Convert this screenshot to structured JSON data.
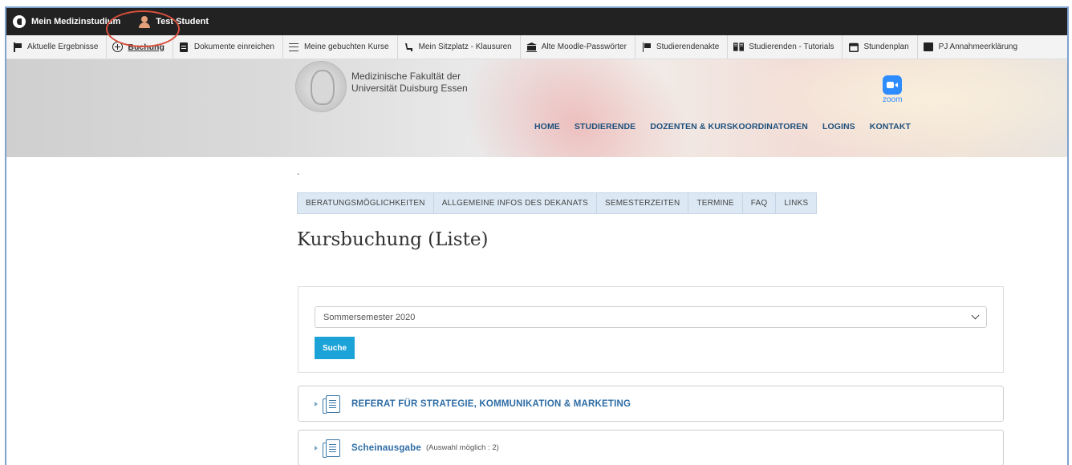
{
  "topbar": {
    "app_title": "Mein Medizinstudium",
    "user_name": "Test Student"
  },
  "navbar": {
    "items": [
      {
        "label": "Aktuelle Ergebnisse",
        "icon": "flag-icon"
      },
      {
        "label": "Buchung",
        "icon": "plus-circle-icon",
        "active": true
      },
      {
        "label": "Dokumente einreichen",
        "icon": "clipboard-icon"
      },
      {
        "label": "Meine gebuchten Kurse",
        "icon": "list-icon"
      },
      {
        "label": "Mein Sitzplatz - Klausuren",
        "icon": "seat-icon"
      },
      {
        "label": "Alte Moodle-Passwörter",
        "icon": "university-icon"
      },
      {
        "label": "Studierendenakte",
        "icon": "flag-icon"
      },
      {
        "label": "Studierenden - Tutorials",
        "icon": "book-icon"
      },
      {
        "label": "Stundenplan",
        "icon": "calendar-icon"
      },
      {
        "label": "PJ Annahmeerklärung",
        "icon": "document-icon"
      }
    ]
  },
  "header": {
    "faculty_line1": "Medizinische Fakultät der",
    "faculty_line2": "Universität Duisburg Essen",
    "zoom_label": "zoom",
    "mainnav": [
      "HOME",
      "STUDIERENDE",
      "DOZENTEN & KURSKOORDINATOREN",
      "LOGINS",
      "KONTAKT"
    ]
  },
  "content": {
    "dash": "-",
    "tabs": [
      "BERATUNGSMÖGLICHKEITEN",
      "ALLGEMEINE INFOS DES DEKANATS",
      "SEMESTERZEITEN",
      "TERMINE",
      "FAQ",
      "LINKS"
    ],
    "page_title": "Kursbuchung (Liste)",
    "search": {
      "selected_semester": "Sommersemester 2020",
      "button_label": "Suche"
    },
    "accordion": [
      {
        "title": "REFERAT FÜR STRATEGIE, KOMMUNIKATION & MARKETING",
        "subtitle": ""
      },
      {
        "title": "Scheinausgabe",
        "subtitle": "(Auswahl möglich : 2)"
      }
    ]
  },
  "colors": {
    "accent": "#1ba3d8",
    "nav_text": "#1d4f7c",
    "annotation": "#d9503c"
  }
}
